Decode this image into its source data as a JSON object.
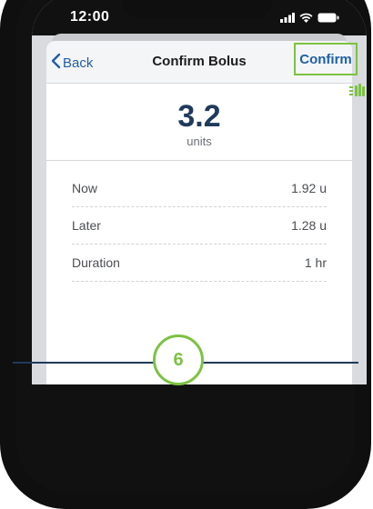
{
  "status": {
    "time": "12:00"
  },
  "nav": {
    "back_label": "Back",
    "title": "Confirm Bolus",
    "confirm_label": "Confirm"
  },
  "bolus": {
    "amount": "3.2",
    "unit": "units",
    "rows": [
      {
        "label": "Now",
        "value": "1.92 u"
      },
      {
        "label": "Later",
        "value": "1.28 u"
      },
      {
        "label": "Duration",
        "value": "1 hr"
      }
    ]
  },
  "step": {
    "number": "6"
  },
  "icons": {
    "back": "chevron-left-icon",
    "signal": "signal-icon",
    "wifi": "wifi-icon",
    "battery": "battery-icon",
    "tap": "tap-hand-icon"
  },
  "colors": {
    "accent_blue": "#1f5fa8",
    "highlight_green": "#7cc242",
    "amount_navy": "#1f3a5c"
  }
}
